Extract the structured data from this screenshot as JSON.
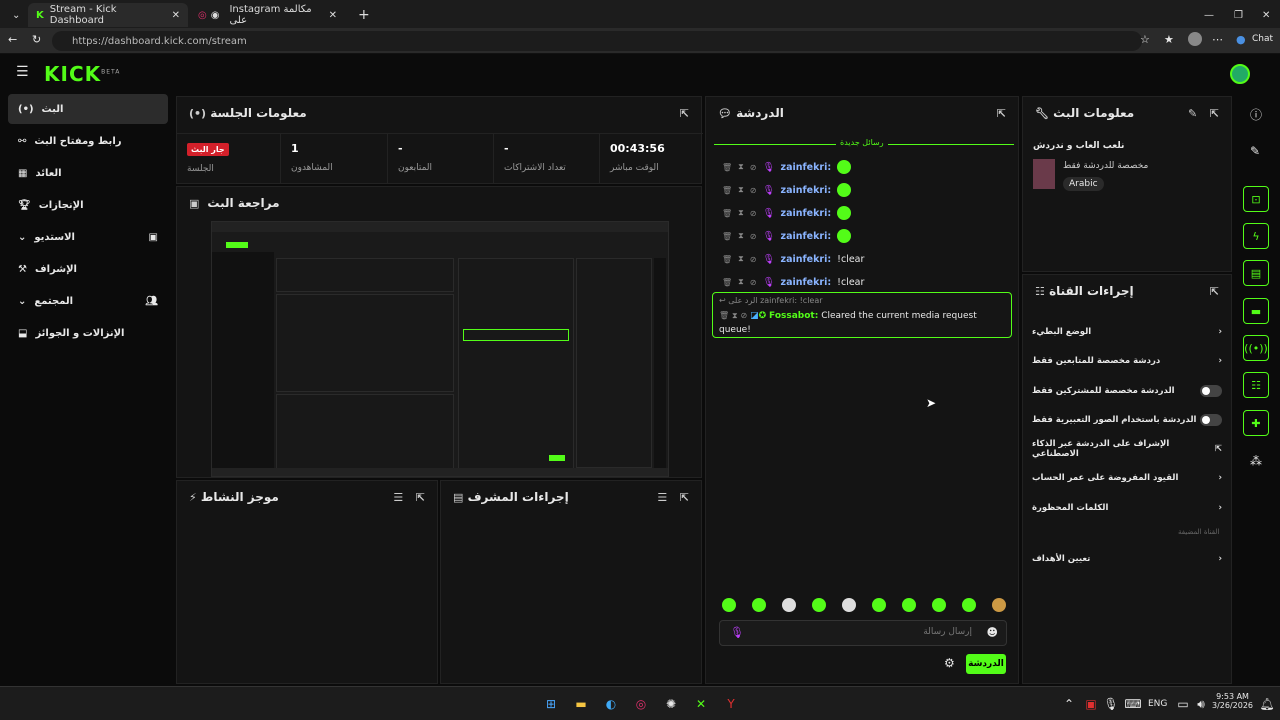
{
  "browser": {
    "tab1_title": "Stream - Kick Dashboard",
    "tab2_title": "Instagram مكالمة على",
    "url": "https://dashboard.kick.com/stream",
    "chat_label": "Chat"
  },
  "header": {
    "logo": "KICK",
    "logo_badge": "BETA"
  },
  "sidebar": {
    "items": [
      {
        "label": "البث"
      },
      {
        "label": "رابط ومفتاح البث"
      },
      {
        "label": "العائد"
      },
      {
        "label": "الإنجازات"
      },
      {
        "label": "الاستديو"
      },
      {
        "label": "الإشراف"
      },
      {
        "label": "المجتمع"
      },
      {
        "label": "الإنزالات و الجوائز"
      }
    ]
  },
  "session": {
    "title": "معلومات الجلسة",
    "live_badge": "جار البث",
    "session_label": "الجلسة",
    "viewers_value": "1",
    "viewers_label": "المشاهدون",
    "followers_value": "-",
    "followers_label": "المتابعون",
    "subs_value": "-",
    "subs_label": "تعداد الاشتراكات",
    "uptime_value": "00:43:56",
    "uptime_label": "الوقت مباشر"
  },
  "preview": {
    "title": "مراجعة البث"
  },
  "activity": {
    "title": "موجز النشاط"
  },
  "modactions": {
    "title": "إجراءات المشرف"
  },
  "chat": {
    "title": "الدردشة",
    "new_messages": "رسائل جديدة",
    "messages": [
      {
        "user": "zainfekri:",
        "text": ""
      },
      {
        "user": "zainfekri:",
        "text": ""
      },
      {
        "user": "zainfekri:",
        "text": ""
      },
      {
        "user": "zainfekri:",
        "text": ""
      },
      {
        "user": "zainfekri:",
        "text": "!clear"
      },
      {
        "user": "zainfekri:",
        "text": "!clear"
      }
    ],
    "reply_to": "الرد على zainfekri: !clear",
    "bot_name": "Fossabot:",
    "bot_text": "Cleared the current media request queue!",
    "input_placeholder": "إرسال رسالة",
    "send_label": "الدردشة"
  },
  "stream_info": {
    "title": "معلومات البث",
    "stream_title": "نلعب العاب و ندردش",
    "category": "مخصصة للدردشة فقط",
    "language": "Arabic"
  },
  "channel_actions": {
    "title": "إجراءات القناة",
    "rows": [
      {
        "label": "الوضع البطيء"
      },
      {
        "label": "دردشة مخصصة للمتابعين فقط"
      },
      {
        "label": "الدردشة مخصصة للمشتركين فقط"
      },
      {
        "label": "الدردشة باستخدام الصور التعبيرية فقط"
      },
      {
        "label": "الإشراف على الدردشة عبر الذكاء الاصطناعي"
      },
      {
        "label": "القيود المفروضة على عمر الحساب"
      },
      {
        "label": "الكلمات المحظورة"
      }
    ],
    "section_label": "القناة المضيفة",
    "goals_label": "تعيين الأهداف"
  },
  "taskbar": {
    "lang": "ENG",
    "time": "9:53 AM",
    "date": "3/26/2026"
  },
  "colors": {
    "accent": "#53fc18",
    "live": "#d3202a"
  }
}
